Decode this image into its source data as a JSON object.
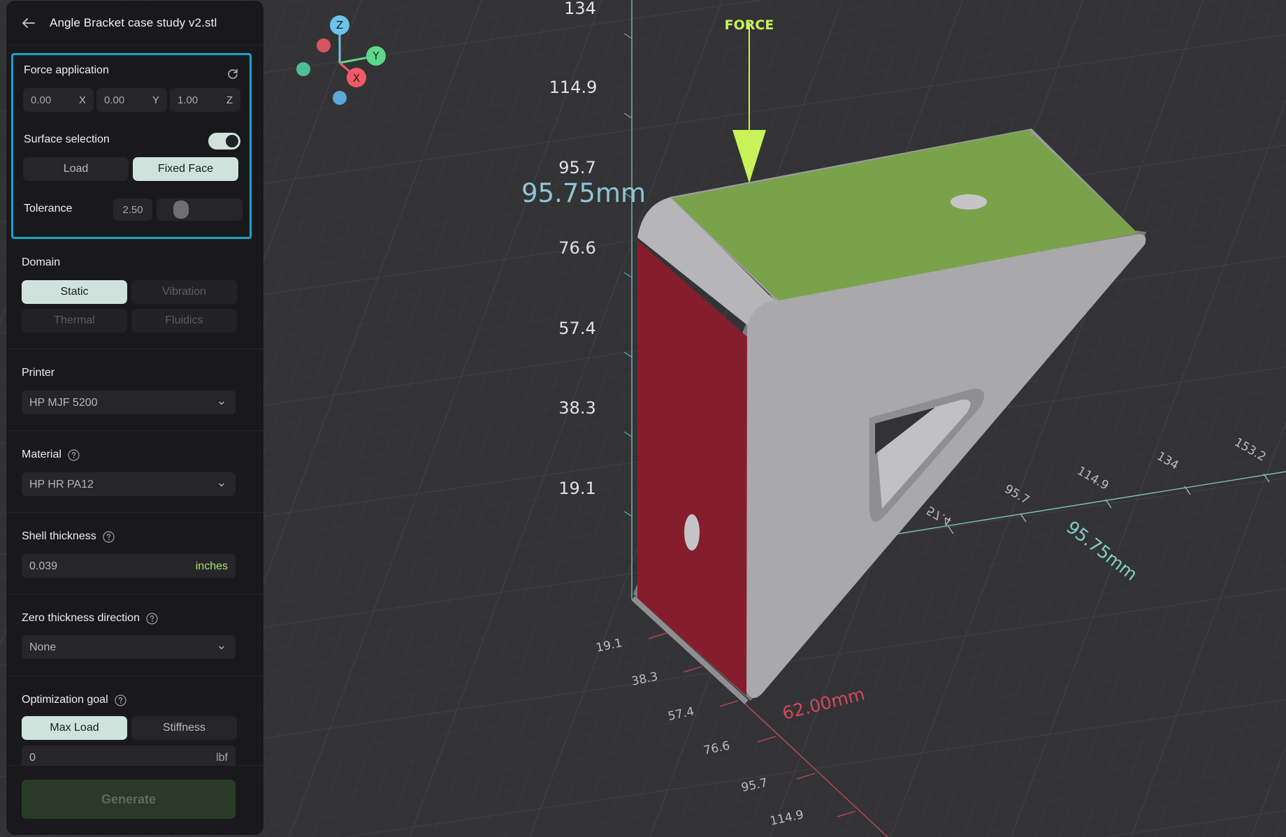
{
  "panel": {
    "title": "Angle Bracket case study v2.stl",
    "force_application": {
      "label": "Force application",
      "x": "0.00",
      "x_axis": "X",
      "y": "0.00",
      "y_axis": "Y",
      "z": "1.00",
      "z_axis": "Z",
      "surface_selection_label": "Surface selection",
      "surface_selection_on": true,
      "load_label": "Load",
      "fixed_face_label": "Fixed Face",
      "tolerance_label": "Tolerance",
      "tolerance_value": "2.50"
    },
    "domain": {
      "label": "Domain",
      "options": [
        "Static",
        "Vibration",
        "Thermal",
        "Fluidics"
      ],
      "selected": "Static"
    },
    "printer": {
      "label": "Printer",
      "value": "HP MJF 5200"
    },
    "material": {
      "label": "Material",
      "value": "HP HR PA12"
    },
    "shell_thickness": {
      "label": "Shell thickness",
      "value": "0.039",
      "unit": "inches"
    },
    "zero_thickness": {
      "label": "Zero thickness direction",
      "value": "None"
    },
    "optimization_goal": {
      "label": "Optimization goal",
      "options": [
        "Max Load",
        "Stiffness"
      ],
      "selected": "Max Load",
      "value": "0",
      "unit": "lbf"
    },
    "generate_label": "Generate"
  },
  "viewport": {
    "force_label": "FORCE",
    "gizmo": {
      "x": "X",
      "y": "Y",
      "z": "Z"
    },
    "vertical_ticks": [
      "134",
      "114.9",
      "95.7",
      "76.6",
      "57.4",
      "38.3",
      "19.1"
    ],
    "height_dimension": "95.75mm",
    "width_dimension": "62.00mm",
    "depth_dimension": "95.75mm",
    "front_ticks": [
      "19.1",
      "38.3",
      "57.4",
      "76.6",
      "95.7",
      "114.9"
    ],
    "right_ticks": [
      "57.4",
      "95.7",
      "114.9",
      "134",
      "153.2"
    ],
    "colors": {
      "background": "#333335",
      "fixed_face": "#861d2c",
      "load_face": "#7aa24a",
      "body": "#a8a8aa",
      "force_arrow": "#c7f25a",
      "accent": "#1aa3c9"
    }
  }
}
